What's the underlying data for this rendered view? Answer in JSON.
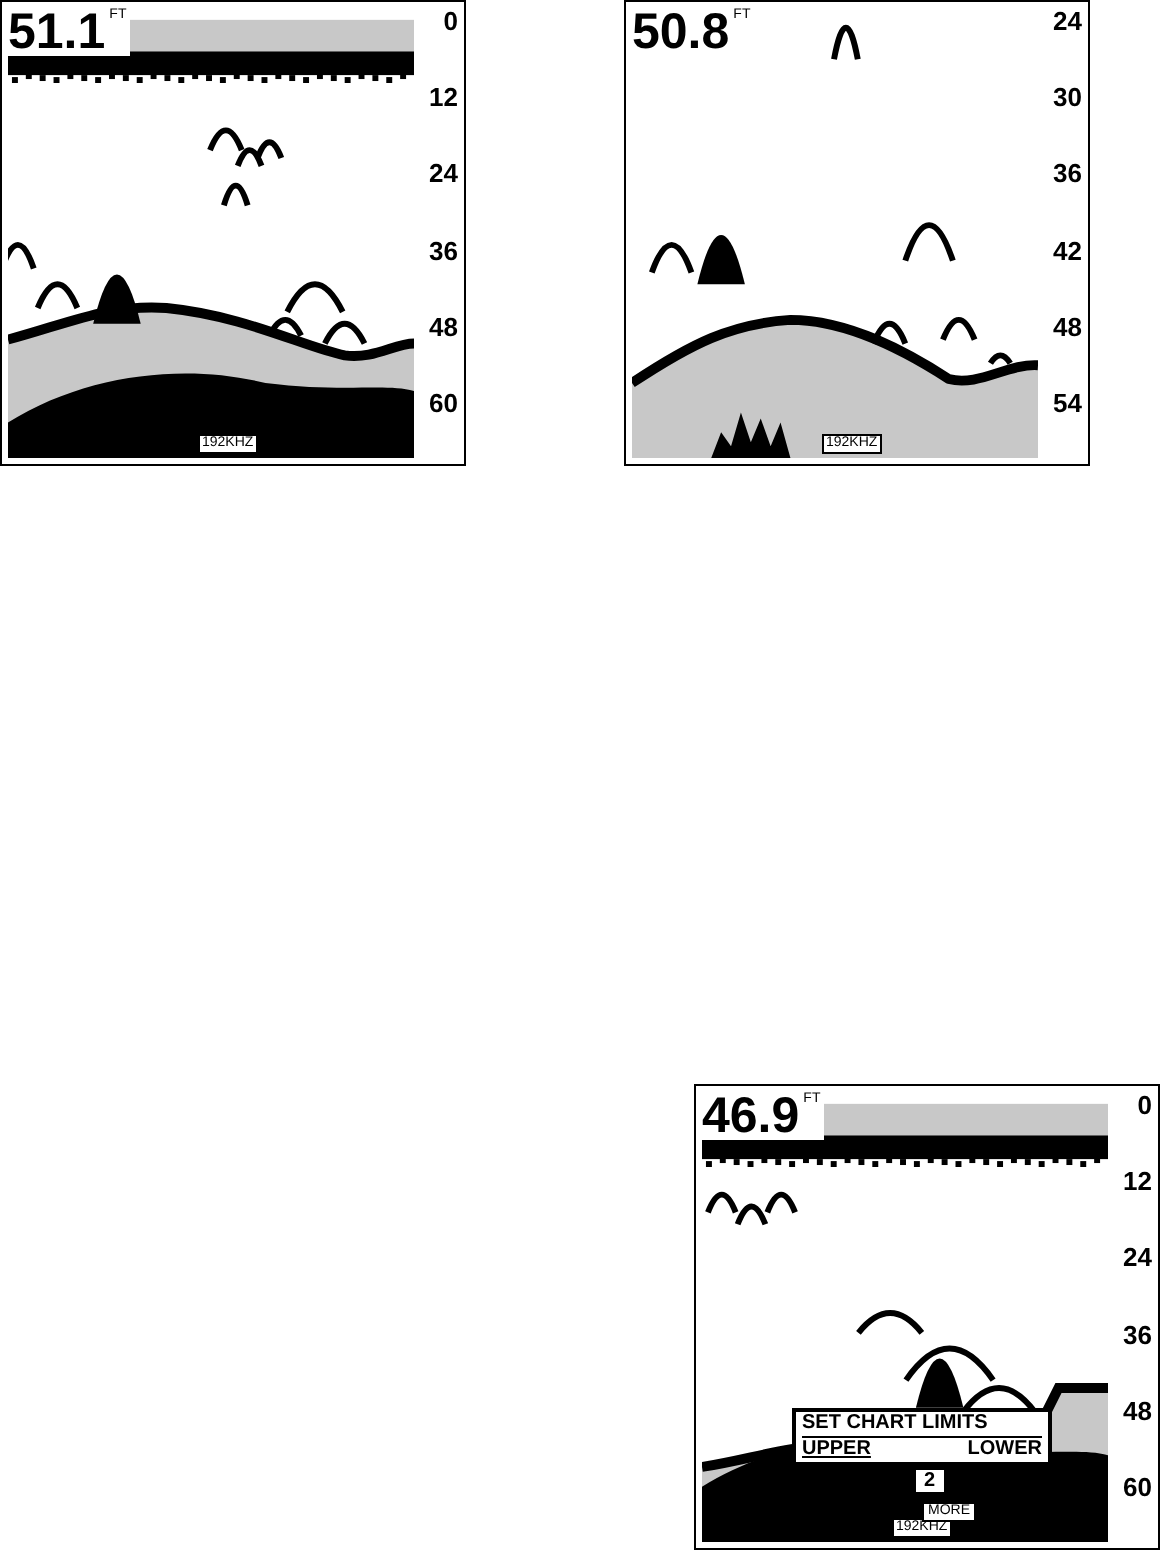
{
  "screens": [
    {
      "depth": "51.1",
      "unit": "FT",
      "frequency": "192KHZ",
      "surface_band": true,
      "scale": [
        "0",
        "12",
        "24",
        "36",
        "48",
        "60"
      ]
    },
    {
      "depth": "50.8",
      "unit": "FT",
      "frequency": "192KHZ",
      "surface_band": false,
      "scale": [
        "24",
        "30",
        "36",
        "42",
        "48",
        "54"
      ]
    },
    {
      "depth": "46.9",
      "unit": "FT",
      "frequency": "192KHZ",
      "surface_band": true,
      "scale": [
        "0",
        "12",
        "24",
        "36",
        "48",
        "60"
      ],
      "dialog": {
        "title": "SET CHART LIMITS",
        "options": [
          {
            "label": "UPPER",
            "selected": true
          },
          {
            "label": "LOWER",
            "selected": false
          }
        ],
        "value": "2",
        "button": "MORE"
      }
    }
  ]
}
